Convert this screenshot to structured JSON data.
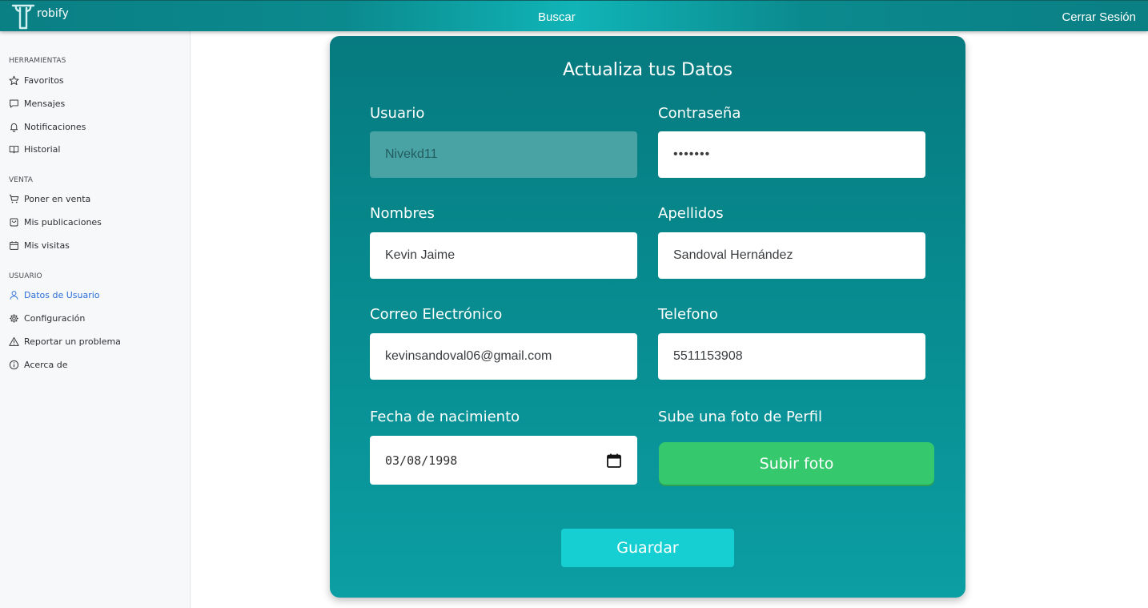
{
  "topbar": {
    "brand": "robify",
    "search": "Buscar",
    "logout": "Cerrar Sesión"
  },
  "sidebar": {
    "sections": [
      {
        "title": "HERRAMIENTAS",
        "items": [
          {
            "label": "Favoritos",
            "icon": "star-icon"
          },
          {
            "label": "Mensajes",
            "icon": "message-icon"
          },
          {
            "label": "Notificaciones",
            "icon": "bell-icon"
          },
          {
            "label": "Historial",
            "icon": "book-icon"
          }
        ]
      },
      {
        "title": "VENTA",
        "items": [
          {
            "label": "Poner en venta",
            "icon": "cart-icon"
          },
          {
            "label": "Mis publicaciones",
            "icon": "bag-icon"
          },
          {
            "label": "Mis visitas",
            "icon": "calendar-icon"
          }
        ]
      },
      {
        "title": "USUARIO",
        "items": [
          {
            "label": "Datos de Usuario",
            "icon": "user-icon",
            "active": true
          },
          {
            "label": "Configuración",
            "icon": "gear-icon"
          },
          {
            "label": "Reportar un problema",
            "icon": "warning-icon"
          },
          {
            "label": "Acerca de",
            "icon": "info-icon"
          }
        ]
      }
    ]
  },
  "form": {
    "title": "Actualiza tus Datos",
    "usuario": {
      "label": "Usuario",
      "value": "Nivekd11"
    },
    "password": {
      "label": "Contraseña",
      "value": "•••••••"
    },
    "nombres": {
      "label": "Nombres",
      "value": "Kevin Jaime"
    },
    "apellidos": {
      "label": "Apellidos",
      "value": "Sandoval Hernández"
    },
    "correo": {
      "label": "Correo Electrónico",
      "value": "kevinsandoval06@gmail.com"
    },
    "telefono": {
      "label": "Telefono",
      "value": "5511153908"
    },
    "nacimiento": {
      "label": "Fecha de nacimiento",
      "value": "03/08/1998"
    },
    "foto": {
      "label": "Sube una foto de Perfil",
      "button": "Subir foto"
    },
    "save": "Guardar"
  },
  "colors": {
    "topbar": "#0b8a8e",
    "card": "#07898d",
    "upload_button": "#36c86c",
    "save_button": "#16cfd3",
    "active_item": "#2a6fd6"
  }
}
